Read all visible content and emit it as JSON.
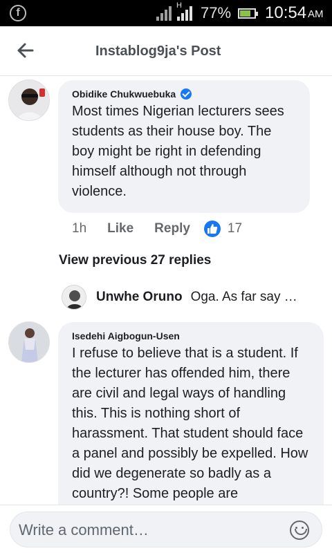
{
  "status_bar": {
    "app_icon": "facebook-icon",
    "battery_percent": "77%",
    "battery_level": 0.77,
    "time": "10:54",
    "ampm": "AM",
    "network_mark": "H"
  },
  "header": {
    "title": "Instablog9ja's Post",
    "back_icon": "arrow-left-icon"
  },
  "comments": [
    {
      "author": "Obidike Chukwuebuka",
      "verified": true,
      "text": "Most times Nigerian lecturers sees students as their house boy. The boy might be right in defending himself although not through violence.",
      "time_ago": "1h",
      "like_label": "Like",
      "reply_label": "Reply",
      "reaction_count": "17"
    },
    {
      "author": "Isedehi Aigbogun-Usen",
      "text": "I refuse to believe that is a student. If the lecturer has offended him, there are civil and legal ways of handling this. This is nothing short of harassment. That student should face a panel and possibly be expelled. How did we degenerate so badly as a country?! Some people are"
    }
  ],
  "replies": {
    "view_previous_label": "View previous 27 replies",
    "latest_author": "Unwhe Oruno",
    "latest_text": "Oga. As far say …"
  },
  "composer": {
    "placeholder": "Write a comment…",
    "emoji_icon": "smiley-icon"
  },
  "colors": {
    "accent": "#1877f2",
    "bubble": "#f0f2f5",
    "muted_text": "#65676b"
  }
}
